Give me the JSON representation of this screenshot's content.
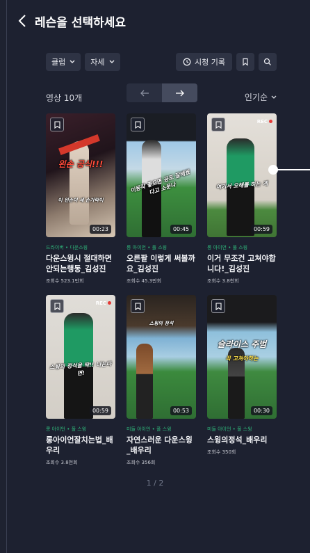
{
  "header": {
    "title": "레슨을 선택하세요"
  },
  "filters": [
    {
      "label": "클럽"
    },
    {
      "label": "자세"
    }
  ],
  "tools": {
    "history_label": "시청 기록"
  },
  "list": {
    "count_label": "영상 10개",
    "sort_label": "인기순"
  },
  "videos": [
    {
      "category": "드라이버 • 다운스윙",
      "title": "다운스윙시 절대하면 안되는행동_김성진",
      "views": "조회수 523.1만회",
      "duration": "00:23",
      "caption": "왼손 공식!!!",
      "caption2": "이 왼손이 세 손가락이"
    },
    {
      "category": "롱 아이언 • 풀 스윙",
      "title": "오른팔 이렇게 써볼까요_김성진",
      "views": "조회수 45.3만회",
      "duration": "00:45",
      "caption": "이동작 좋으면 공포 잘배웠다고 소문나"
    },
    {
      "category": "롱 아이언 • 풀 스윙",
      "title": "이거 무조건 고쳐야합니다!_김성진",
      "views": "조회수 3.8천회",
      "duration": "00:59",
      "caption": "여기서 오해를 하는 게",
      "rec": "REC"
    },
    {
      "category": "롱 아이언 • 풀 스윙",
      "title": "롱아이언잘치는법_배우리",
      "views": "조회수 3.8천회",
      "duration": "00:59",
      "caption": "스윙의 정석을 딱!! 나눈다면!",
      "rec": "REC"
    },
    {
      "category": "미들 아이언 • 풀 스윙",
      "title": "자연스러운 다운스윙_배우리",
      "views": "조회수 356회",
      "duration": "00:53",
      "caption": "스윙의 정석"
    },
    {
      "category": "미들 아이언 • 풀 스윙",
      "title": "스윙의정석_배우리",
      "views": "조회수 350회",
      "duration": "00:30",
      "caption": "슬라이스 주범",
      "caption2": "꼭 고쳐야하는"
    }
  ],
  "pagination": {
    "label": "1 / 2"
  }
}
